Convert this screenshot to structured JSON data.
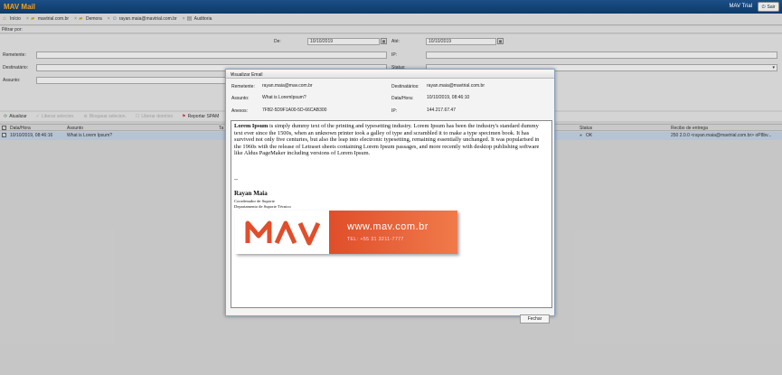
{
  "app": {
    "title": "MAV Mail",
    "license": "MAV Trial",
    "logout_label": "Sair"
  },
  "tabs": [
    {
      "label": "Início",
      "icon": "home-icon"
    },
    {
      "label": "mavtrial.com.br",
      "icon": "folder-icon"
    },
    {
      "label": "Demora",
      "icon": "folder-icon"
    },
    {
      "label": "rayan.maia@mavtrial.com.br",
      "icon": "user-icon"
    },
    {
      "label": "Auditoria",
      "icon": "audit-icon"
    }
  ],
  "filter": {
    "bar_label": "Filtrar por:",
    "de_label": "De:",
    "de_value": "10/10/2019",
    "ate_label": "Até:",
    "ate_value": "10/10/2019",
    "remetente_label": "Remetente:",
    "ip_label": "IP:",
    "destinatario_label": "Destinatário:",
    "status_label": "Status:",
    "assunto_label": "Assunto:"
  },
  "toolbar": {
    "atualizar": "Atualizar",
    "b2": "Liberar selecion.",
    "b3": "Bloquear selecion.",
    "b4": "Liberar domínio",
    "reportar": "Reportar SPAM"
  },
  "grid": {
    "columns": {
      "datetime": "Data/Hora",
      "assunto": "Assunto",
      "ta": "Ta",
      "status": "Status",
      "recibo": "Recibo de entrega"
    },
    "row": {
      "datetime": "10/10/2019, 08:46:16",
      "assunto": "What is Lorem Ipsum?",
      "status": "OK",
      "recibo": "250 2.0.0 <rayan.maia@mavtrial.com.br> oP8bv..."
    }
  },
  "modal": {
    "title": "Visualizar Email",
    "remetente_label": "Remetente:",
    "remetente": "rayan.maia@mav.com.br",
    "destinatarios_label": "Destinatários:",
    "destinatarios": "rayan.maia@mavtrial.com.br",
    "assunto_label": "Assunto:",
    "assunto": "What is LoremIpsum?",
    "datahora_label": "Data/Hora:",
    "datahora": "10/10/2019, 08:46:10",
    "anexos_label": "Anexos:",
    "anexos": "7FB2-5D9F1A00-5D-66CAB300",
    "ip_label": "IP:",
    "ip": "144.217.67.47",
    "body_bold": "Lorem Ipsum",
    "body": " is simply dummy text of the printing and typesetting industry. Lorem Ipsum has been the industry's standard dummy text ever since the 1500s, when an unknown printer took a galley of type and scrambled it to make a type specimen book. It has survived not only five centuries, but also the leap into electronic typesetting, remaining essentially unchanged. It was popularised in the 1960s with the release of Letraset sheets containing Lorem Ipsum passages, and more recently with desktop publishing software like Aldus PageMaker including versions of Lorem Ipsum.",
    "separator": "--",
    "sig_name": "Rayan Maia",
    "sig_role": "Coordenador de Suporte",
    "sig_dept": "Departamento de Suporte Técnico",
    "banner_logo": "MAV",
    "banner_url": "www.mav.com.br",
    "banner_tel": "TEL: +55 31 3211-7777",
    "close_label": "Fechar"
  },
  "colors": {
    "topbar": "#0d3a6a",
    "brand_orange": "#e04e2a",
    "selected_row": "#c6d6ea"
  }
}
